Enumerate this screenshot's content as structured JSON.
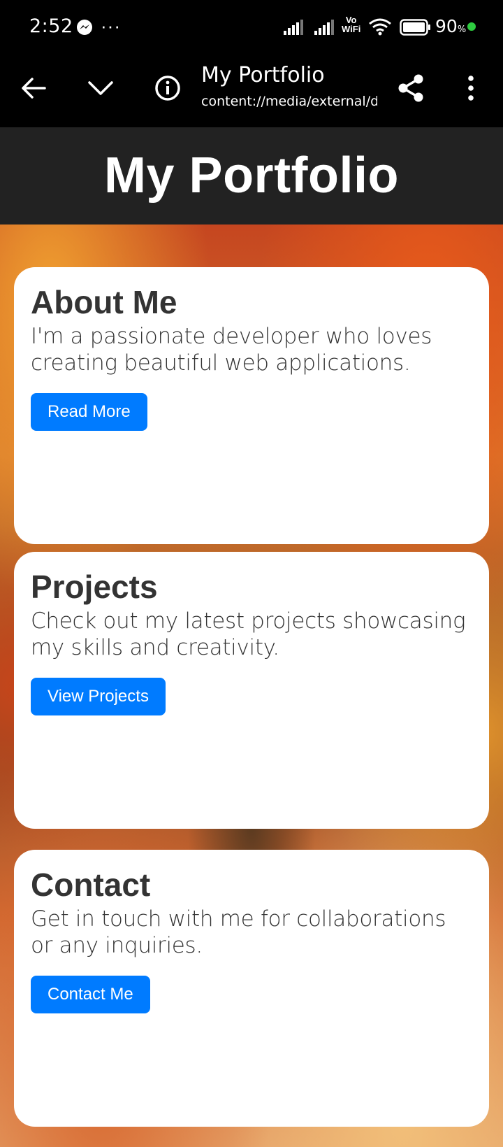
{
  "status_bar": {
    "time": "2:52",
    "battery_percent": "90",
    "battery_unit": "%",
    "vowifi_top": "Vo",
    "vowifi_bottom": "WiFi"
  },
  "browser": {
    "title": "My Portfolio",
    "url": "content://media/external/downloads"
  },
  "page": {
    "title": "My Portfolio"
  },
  "cards": [
    {
      "title": "About Me",
      "text": "I'm a passionate developer who loves creating beautiful web applications.",
      "button": "Read More"
    },
    {
      "title": "Projects",
      "text": "Check out my latest projects showcasing my skills and creativity.",
      "button": "View Projects"
    },
    {
      "title": "Contact",
      "text": "Get in touch with me for collaborations or any inquiries.",
      "button": "Contact Me"
    }
  ],
  "colors": {
    "header_bg": "#222222",
    "button_bg": "#007bff",
    "card_bg": "#ffffff",
    "text": "#333333"
  }
}
